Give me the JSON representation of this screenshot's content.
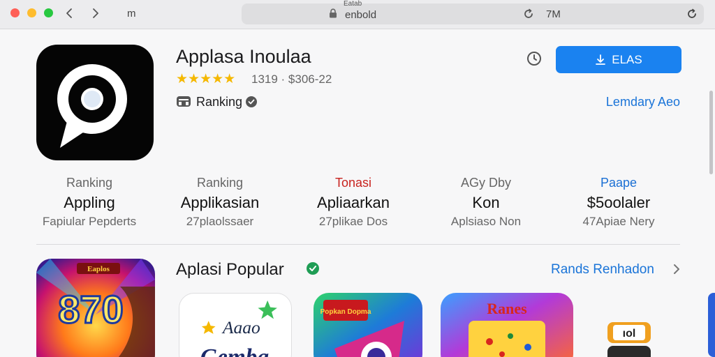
{
  "titlebar": {
    "menu_glyph": "m",
    "url_top": "Eatab",
    "url": "enbold",
    "zoom": "7M"
  },
  "app": {
    "title": "Applasa Inoulaa",
    "stars": "★★★★★",
    "rating_text": "1319 · $306-22",
    "ranking_label": "Ranking",
    "get_label": "ELAS",
    "side_link": "Lemdary Aeo"
  },
  "stats": [
    {
      "label": "Ranking",
      "value": "Appling",
      "sub": "Fapiular Pepderts"
    },
    {
      "label": "Ranking",
      "value": "Applikasian",
      "sub": "27plaolssaer"
    },
    {
      "label": "Tonasi",
      "value": "Apliaarkan",
      "sub": "27plikae Dos"
    },
    {
      "label": "AGy Dby",
      "value": "Kon",
      "sub": "Aplsiaso Non"
    },
    {
      "label": "Paape",
      "value": "$5oolaler",
      "sub": "47Apiae Nery"
    }
  ],
  "popular": {
    "title": "Aplasi Popular",
    "link": "Rands Renhadon",
    "tiles": {
      "big_text": "870",
      "big_top_text": "Eaplos",
      "a_text_top": "Aaao",
      "a_text_bottom": "Gemba",
      "b_text": "Popkan Dopma",
      "c_text": "Ranes",
      "d_text": "ıol"
    }
  },
  "colors": {
    "accent": "#1a82f0",
    "link": "#1a74d8",
    "star": "#f5b800",
    "badge_green": "#1f9d55"
  }
}
